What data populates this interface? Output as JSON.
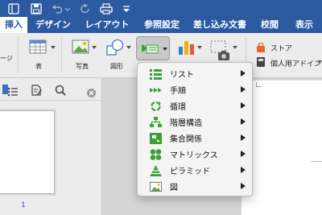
{
  "ribbon_tabs": [
    {
      "label": "挿入",
      "active": true
    },
    {
      "label": "デザイン"
    },
    {
      "label": "レイアウト"
    },
    {
      "label": "参照設定"
    },
    {
      "label": "差し込み文書"
    },
    {
      "label": "校閲"
    },
    {
      "label": "表示"
    }
  ],
  "ribbon": {
    "page_label": "ージ",
    "table_label": "表",
    "photo_label": "写真",
    "shapes_label": "図形",
    "store_label": "ストア",
    "personal_addin_label": "個人用アドイン"
  },
  "smartart_menu": {
    "items": [
      {
        "label": "リスト",
        "icon": "list-icon"
      },
      {
        "label": "手順",
        "icon": "process-icon"
      },
      {
        "label": "循環",
        "icon": "cycle-icon"
      },
      {
        "label": "階層構造",
        "icon": "hierarchy-icon"
      },
      {
        "label": "集合関係",
        "icon": "relationship-icon"
      },
      {
        "label": "マトリックス",
        "icon": "matrix-icon"
      },
      {
        "label": "ピラミッド",
        "icon": "pyramid-icon"
      },
      {
        "label": "図",
        "icon": "picture-icon"
      }
    ]
  },
  "sidebar": {
    "page_number": "1"
  },
  "colors": {
    "brand_blue": "#2c5aa0",
    "icon_green": "#3aa13a",
    "store_orange": "#e8642a"
  }
}
